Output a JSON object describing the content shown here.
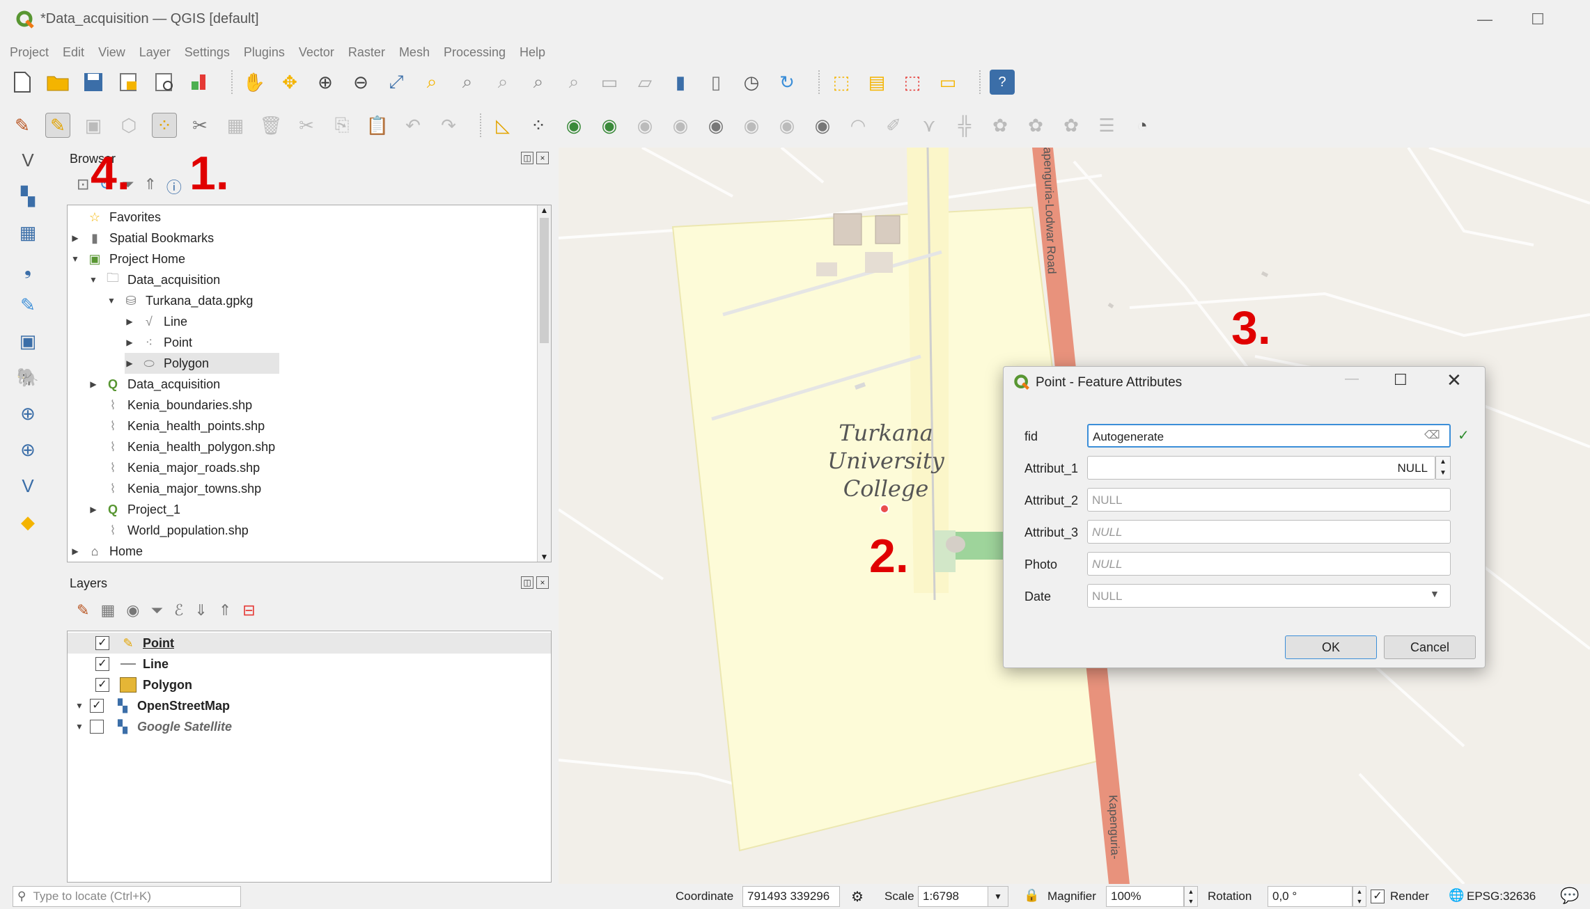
{
  "window": {
    "title": "*Data_acquisition — QGIS [default]",
    "minimize": "—",
    "maximize": "☐"
  },
  "menu": [
    "Project",
    "Edit",
    "View",
    "Layer",
    "Settings",
    "Plugins",
    "Vector",
    "Raster",
    "Mesh",
    "Processing",
    "Help"
  ],
  "browser": {
    "title": "Browser",
    "items": [
      {
        "label": "Favorites",
        "icon": "star-icon"
      },
      {
        "label": "Spatial Bookmarks",
        "icon": "bookmark-icon"
      },
      {
        "label": "Project Home",
        "icon": "project-home-icon"
      },
      {
        "label": "Data_acquisition",
        "icon": "folder-icon"
      },
      {
        "label": "Turkana_data.gpkg",
        "icon": "geopackage-icon"
      },
      {
        "label": "Line",
        "icon": "line-layer-icon"
      },
      {
        "label": "Point",
        "icon": "point-layer-icon"
      },
      {
        "label": "Polygon",
        "icon": "polygon-layer-icon"
      },
      {
        "label": "Data_acquisition",
        "icon": "qgis-project-icon"
      },
      {
        "label": "Kenia_boundaries.shp",
        "icon": "shapefile-icon"
      },
      {
        "label": "Kenia_health_points.shp",
        "icon": "shapefile-icon"
      },
      {
        "label": "Kenia_health_polygon.shp",
        "icon": "shapefile-icon"
      },
      {
        "label": "Kenia_major_roads.shp",
        "icon": "shapefile-icon"
      },
      {
        "label": "Kenia_major_towns.shp",
        "icon": "shapefile-icon"
      },
      {
        "label": "Project_1",
        "icon": "qgis-project-icon"
      },
      {
        "label": "World_population.shp",
        "icon": "shapefile-icon"
      },
      {
        "label": "Home",
        "icon": "home-icon"
      }
    ]
  },
  "layers": {
    "title": "Layers",
    "items": [
      {
        "label": "Point",
        "checked": true
      },
      {
        "label": "Line",
        "checked": true
      },
      {
        "label": "Polygon",
        "checked": true
      },
      {
        "label": "OpenStreetMap",
        "checked": true
      },
      {
        "label": "Google Satellite",
        "checked": false
      }
    ]
  },
  "map": {
    "place_label_1": "Turkana",
    "place_label_2": "University",
    "place_label_3": "College",
    "road_label_top": "Kapenguria-Lodwar Road",
    "road_label_bottom": "Kapenguria-"
  },
  "dialog": {
    "title": "Point - Feature Attributes",
    "fields": [
      {
        "label": "fid",
        "value": "Autogenerate"
      },
      {
        "label": "Attribut_1",
        "value": "NULL"
      },
      {
        "label": "Attribut_2",
        "value": "NULL"
      },
      {
        "label": "Attribut_3",
        "value": "NULL"
      },
      {
        "label": "Photo",
        "value": "NULL"
      },
      {
        "label": "Date",
        "value": "NULL"
      }
    ],
    "ok": "OK",
    "cancel": "Cancel"
  },
  "annotations": [
    "1.",
    "2.",
    "3.",
    "4."
  ],
  "status": {
    "locate_placeholder": "Type to locate (Ctrl+K)",
    "coordinate_label": "Coordinate",
    "coordinate_value": "791493  339296",
    "scale_label": "Scale",
    "scale_value": "1:6798",
    "magnifier_label": "Magnifier",
    "magnifier_value": "100%",
    "rotation_label": "Rotation",
    "rotation_value": "0,0 °",
    "render_label": "Render",
    "crs": "EPSG:32636"
  },
  "colors": {
    "qgis_green": "#589632",
    "annotation_red": "#e00000",
    "map_bg": "#f2efe9",
    "campus_fill": "#fdfbd8",
    "road": "#e8927c"
  }
}
